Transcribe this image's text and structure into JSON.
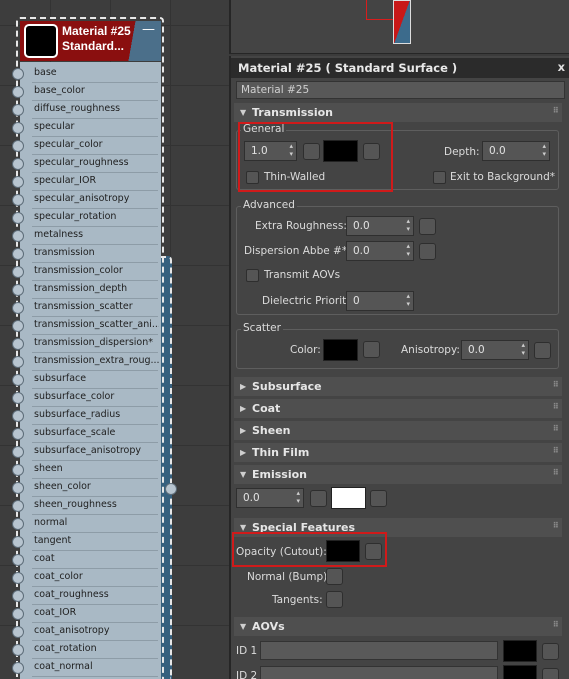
{
  "node": {
    "title_line1": "Material #25",
    "title_line2": "Standard...",
    "minimize": "—",
    "slots": [
      "base",
      "base_color",
      "diffuse_roughness",
      "specular",
      "specular_color",
      "specular_roughness",
      "specular_IOR",
      "specular_anisotropy",
      "specular_rotation",
      "metalness",
      "transmission",
      "transmission_color",
      "transmission_depth",
      "transmission_scatter",
      "transmission_scatter_ani...",
      "transmission_dispersion*",
      "transmission_extra_roug...",
      "subsurface",
      "subsurface_color",
      "subsurface_radius",
      "subsurface_scale",
      "subsurface_anisotropy",
      "sheen",
      "sheen_color",
      "sheen_roughness",
      "normal",
      "tangent",
      "coat",
      "coat_color",
      "coat_roughness",
      "coat_IOR",
      "coat_anisotropy",
      "coat_rotation",
      "coat_normal"
    ]
  },
  "panel": {
    "title": "Material #25  ( Standard Surface )",
    "close": "x",
    "name_value": "Material #25",
    "transmission": {
      "header": "Transmission",
      "general_title": "General",
      "weight_value": "1.0",
      "thin_walled_label": "Thin-Walled",
      "depth_label": "Depth:",
      "depth_value": "0.0",
      "exit_bg_label": "Exit to Background*",
      "advanced_title": "Advanced",
      "extra_roughness_label": "Extra Roughness:",
      "extra_roughness_value": "0.0",
      "dispersion_label": "Dispersion Abbe #*:",
      "dispersion_value": "0.0",
      "transmit_aovs_label": "Transmit AOVs",
      "dielectric_label": "Dielectric Priority",
      "dielectric_value": "0",
      "scatter_title": "Scatter",
      "color_label": "Color:",
      "anisotropy_label": "Anisotropy:",
      "anisotropy_value": "0.0"
    },
    "rollouts": {
      "subsurface": "Subsurface",
      "coat": "Coat",
      "sheen": "Sheen",
      "thin_film": "Thin Film",
      "emission": "Emission",
      "special": "Special Features",
      "aovs": "AOVs"
    },
    "emission_value": "0.0",
    "special": {
      "opacity_label": "Opacity (Cutout):",
      "normal_label": "Normal (Bump):",
      "tangents_label": "Tangents:"
    },
    "aovs": {
      "id1": "ID 1",
      "id2": "ID 2"
    }
  },
  "colors": {
    "highlight": "#d01a1a",
    "node_header": "#8a0f0f",
    "node_body": "#a9b9c5"
  }
}
